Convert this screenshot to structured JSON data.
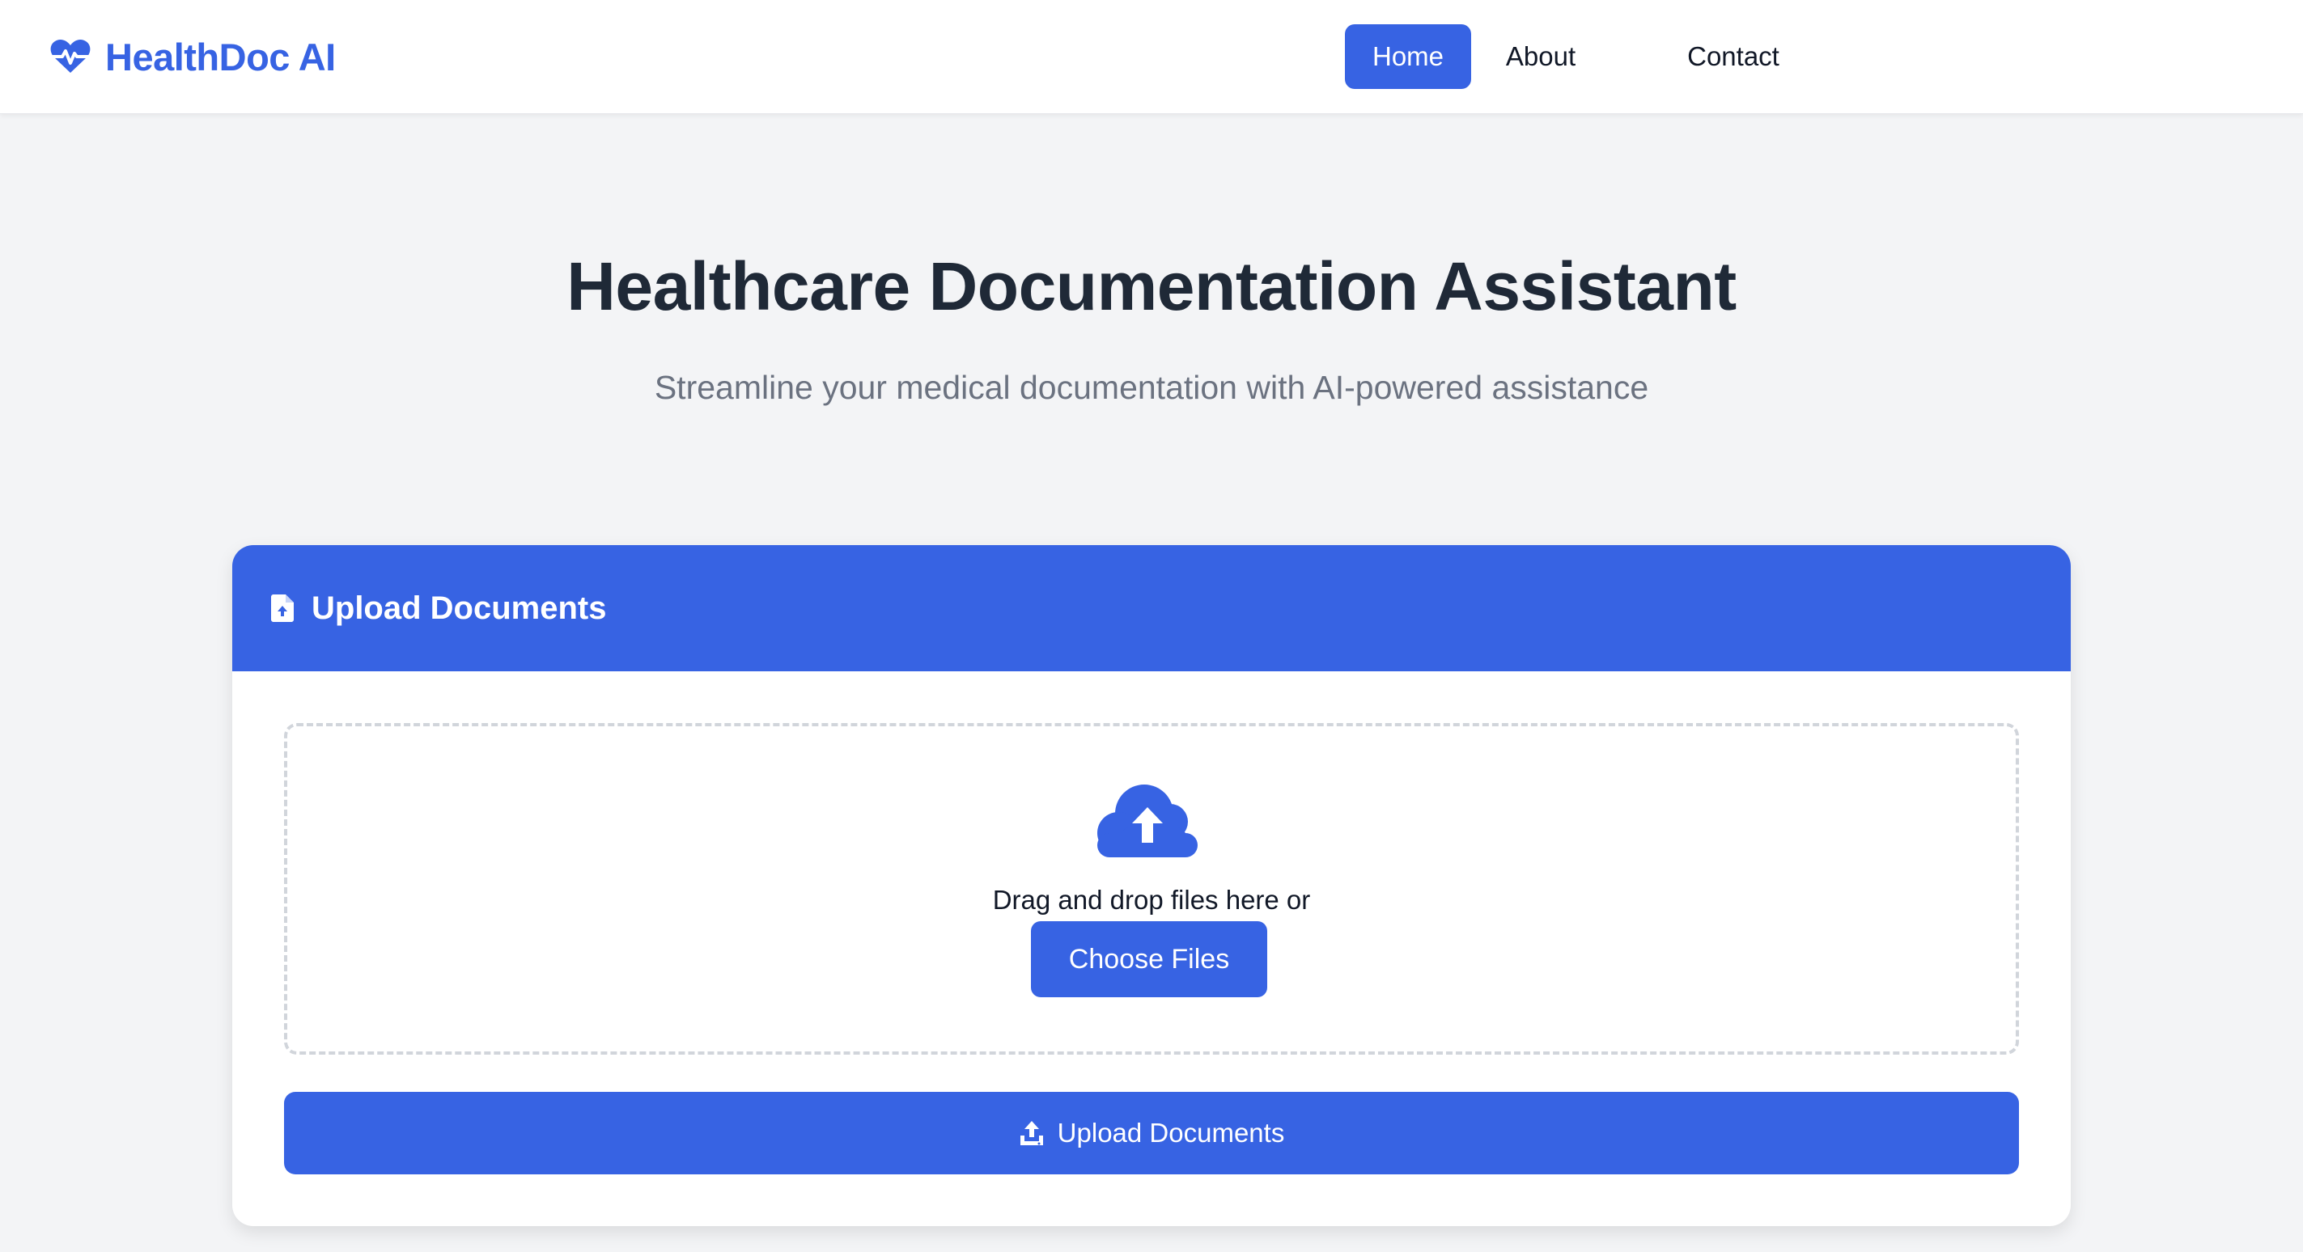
{
  "navbar": {
    "brand_name": "HealthDoc AI",
    "brand_icon": "heart-pulse-icon",
    "links": [
      {
        "label": "Home",
        "active": true
      },
      {
        "label": "About",
        "active": false
      },
      {
        "label": "Contact",
        "active": false
      }
    ]
  },
  "hero": {
    "title": "Healthcare Documentation Assistant",
    "subtitle": "Streamline your medical documentation with AI-powered assistance"
  },
  "upload_card": {
    "header_icon": "file-upload-icon",
    "title": "Upload Documents",
    "dropzone": {
      "icon": "cloud-upload-icon",
      "text": "Drag and drop files here or",
      "choose_label": "Choose Files"
    },
    "submit": {
      "icon": "upload-icon",
      "label": "Upload Documents"
    }
  },
  "colors": {
    "accent": "#3763e3",
    "background": "#f3f4f6",
    "heading": "#1f2937",
    "muted": "#6b7280"
  }
}
